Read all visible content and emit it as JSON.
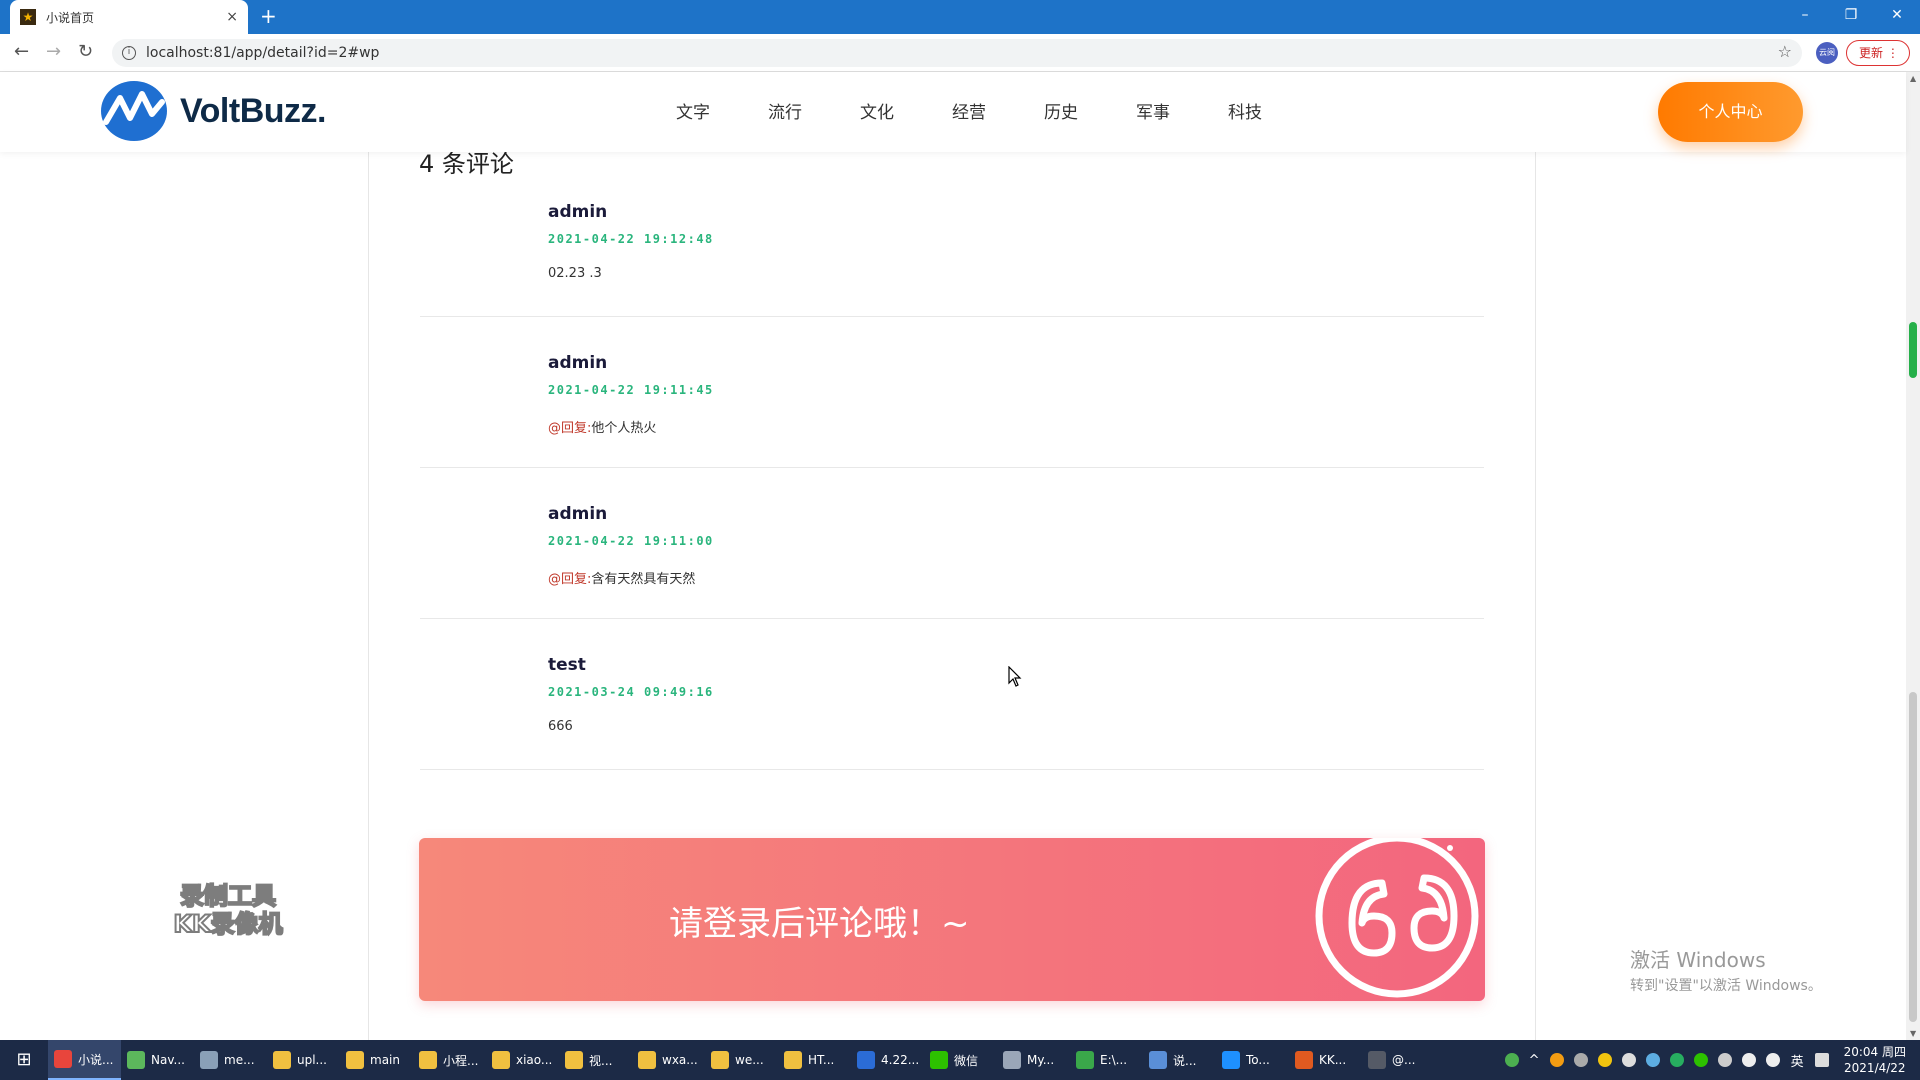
{
  "browser": {
    "tab_title": "小说首页",
    "new_tab": "+",
    "tab_close": "×",
    "url": "localhost:81/app/detail?id=2#wp",
    "update_label": "更新",
    "ext_label": "云阅",
    "win_controls": [
      "–",
      "❐",
      "✕"
    ],
    "nav": {
      "back": "←",
      "forward": "→",
      "reload": "↻",
      "star": "☆"
    }
  },
  "site": {
    "logo_text": "VoltBuzz.",
    "nav_items": [
      "文字",
      "流行",
      "文化",
      "经营",
      "历史",
      "军事",
      "科技"
    ],
    "user_center": "个人中心",
    "accent": "#ff7a00"
  },
  "comments": {
    "count_label": "4 条评论",
    "items": [
      {
        "name": "admin",
        "time": "2021-04-22 19:12:48",
        "prefix": "",
        "text": "02.23 .3"
      },
      {
        "name": "admin",
        "time": "2021-04-22 19:11:45",
        "prefix": "@回复:",
        "text": "他个人热火"
      },
      {
        "name": "admin",
        "time": "2021-04-22 19:11:00",
        "prefix": "@回复:",
        "text": "含有天然具有天然"
      },
      {
        "name": "test",
        "time": "2021-03-24 09:49:16",
        "prefix": "",
        "text": "666"
      }
    ]
  },
  "login_banner": {
    "message": "请登录后评论哦！~"
  },
  "watermarks": {
    "left_line1": "录制工具",
    "left_line2": "KK录像机",
    "activate_title": "激活 Windows",
    "activate_sub": "转到\"设置\"以激活 Windows。"
  },
  "taskbar": {
    "start_icon": "⊞",
    "tasks": [
      {
        "label": "小说...",
        "color": "#e8453c",
        "active": true
      },
      {
        "label": "Nav...",
        "color": "#5cb85c",
        "active": false
      },
      {
        "label": "me...",
        "color": "#8aa0b8",
        "active": false
      },
      {
        "label": "upl...",
        "color": "#f0c040",
        "active": false
      },
      {
        "label": "main",
        "color": "#f0c040",
        "active": false
      },
      {
        "label": "小程...",
        "color": "#f0c040",
        "active": false
      },
      {
        "label": "xiao...",
        "color": "#f0c040",
        "active": false
      },
      {
        "label": "视...",
        "color": "#f0c040",
        "active": false
      },
      {
        "label": "wxa...",
        "color": "#f0c040",
        "active": false
      },
      {
        "label": "we...",
        "color": "#f0c040",
        "active": false
      },
      {
        "label": "HT...",
        "color": "#f0c040",
        "active": false
      },
      {
        "label": "4.22...",
        "color": "#2b6cd6",
        "active": false
      },
      {
        "label": "微信",
        "color": "#2dc100",
        "active": false
      },
      {
        "label": "My...",
        "color": "#9aa6b8",
        "active": false
      },
      {
        "label": "E:\\...",
        "color": "#3aa84a",
        "active": false
      },
      {
        "label": "说...",
        "color": "#5a8fd8",
        "active": false
      },
      {
        "label": "To...",
        "color": "#1e90ff",
        "active": false
      },
      {
        "label": "KK...",
        "color": "#e05a20",
        "active": false
      },
      {
        "label": "@...",
        "color": "#555a66",
        "active": false
      }
    ],
    "ime": "英",
    "time": "20:04 周四",
    "date": "2021/4/22"
  }
}
